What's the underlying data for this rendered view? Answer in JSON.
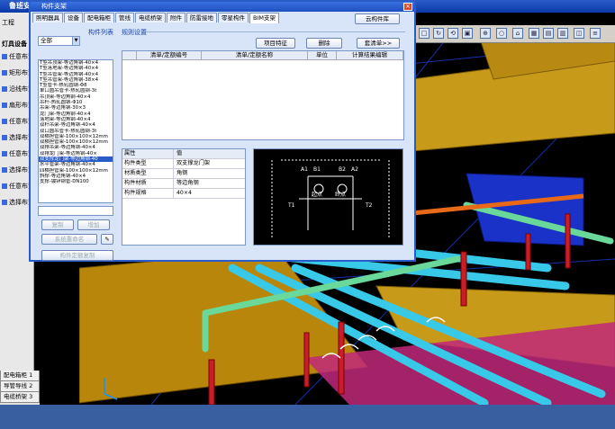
{
  "app": {
    "title": "鲁班安装"
  },
  "left_panel": {
    "header": "工程",
    "category": "灯具设备",
    "items": [
      "任意布置",
      "矩形布置",
      "沿线布置",
      "扇形布置",
      "任意布置",
      "选择布置",
      "任意布置",
      "选择布置",
      "任意布置",
      "选择布置"
    ],
    "tabs": [
      "配电箱柜 1",
      "导管导线 2",
      "电缆桥架 3"
    ]
  },
  "dialog": {
    "title": "构件支架",
    "close_label": "×",
    "tabs": [
      "照明器具",
      "设备",
      "配电箱柜",
      "管线",
      "电缆桥架",
      "附件",
      "防雷接地",
      "零星构件",
      "BIM支架"
    ],
    "active_tab": 8,
    "cloud_button": "云构件库",
    "left_group_label": "构件列表",
    "filter": {
      "value": "全部",
      "arrow": "▼"
    },
    "component_list": [
      "T型吊顶架-等边角钢-40×4",
      "T型落地架-等边角钢-40×4",
      "T型吊管架-等边角钢-40×4",
      "T型吊管架-等边角钢-38×4",
      "T型管卡-热轧圆钢-Φ8",
      "单口圆吊管卡-热轧圆钢-3t",
      "吊顶架-等边角钢-40×4",
      "吊杆-热轧圆钢-Φ10",
      "吊架-等边角钢-30×3",
      "龙门架-等边角钢-40×4",
      "落地架-等边角钢-40×4",
      "双杆吊架-等边角钢-40×4",
      "双口圆吊管卡-热轧圆钢-3t",
      "双横担管架-100×100×12mm",
      "双横担管架-100×100×12mm",
      "双排吊架-等边角钢-40×4",
      "双排龙门架-等边角钢-40×",
      "双支撑龙门架-等边角钢-40",
      "水平管架-等边角钢-40×4",
      "四横担管架-100×100×12mm",
      "斜撑-等边角钢-40×4",
      "支撑-镀锌钢管-DN100"
    ],
    "selected_index": 17,
    "buttons": {
      "copy": "复制",
      "add": "增加",
      "rename": "系统重命名",
      "rename_icon": "✎",
      "custom_copy": "构件定额复制"
    },
    "right_group_label": "规则设置",
    "toolbar": {
      "features": "项目特征",
      "delete": "删除",
      "set_quota": "套清单>>"
    },
    "rule_table": {
      "headers": [
        "",
        "清单/定额编号",
        "清单/定额名称",
        "单位",
        "计算结果编辑"
      ]
    },
    "properties": {
      "headers": [
        "属性",
        "值"
      ],
      "rows": [
        {
          "k": "构件类型",
          "v": "双支撑龙门架"
        },
        {
          "k": "材质类型",
          "v": "角钢"
        },
        {
          "k": "构件材质",
          "v": "等边角钢"
        },
        {
          "k": "构件规格",
          "v": "40×4"
        }
      ]
    },
    "preview": {
      "labels": [
        "A1",
        "B1",
        "B2",
        "A2",
        "起点",
        "终点",
        "T1",
        "T2"
      ]
    }
  },
  "main_toolbar": {
    "icons": [
      "□",
      "↻",
      "⟲",
      "▣",
      "⊕",
      "○",
      "⌂",
      "▦",
      "▤",
      "▥",
      "◫",
      "≡"
    ]
  },
  "colors": {
    "dialog_bg": "#d8e4f8",
    "title_blue": "#2a5cc8",
    "pipe_cyan": "#38c8e8",
    "pipe_green": "#6ad898",
    "tray_orange": "#c89a1a",
    "support_red": "#c81e2a"
  }
}
